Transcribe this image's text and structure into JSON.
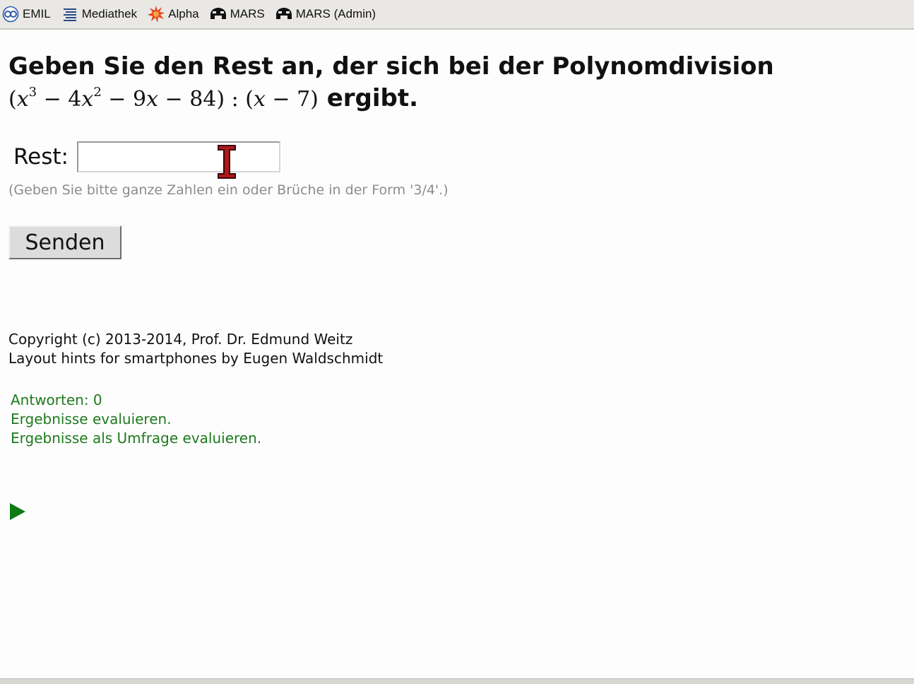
{
  "toolbar": {
    "bookmarks": [
      {
        "label": "EMIL",
        "icon": "emil-logo-icon"
      },
      {
        "label": "Mediathek",
        "icon": "list-icon"
      },
      {
        "label": "Alpha",
        "icon": "starburst-icon"
      },
      {
        "label": "MARS",
        "icon": "mars-logo-icon"
      },
      {
        "label": "MARS (Admin)",
        "icon": "mars-logo-icon"
      }
    ]
  },
  "question": {
    "text_before": "Geben Sie den Rest an, der sich bei der Polynomdivision",
    "formula": "(x³ − 4x² − 9x − 84) : (x − 7)",
    "text_after": "ergibt."
  },
  "answer": {
    "label": "Rest:",
    "value": "",
    "hint": "(Geben Sie bitte ganze Zahlen ein oder Brüche in der Form '3/4'.)",
    "submit_label": "Senden"
  },
  "footer": {
    "copyright": "Copyright (c) 2013-2014, Prof. Dr. Edmund Weitz",
    "layout_hints": "Layout hints for smartphones by Eugen Waldschmidt"
  },
  "stats": {
    "answers": "Antworten: 0",
    "evaluate": "Ergebnisse evaluieren.",
    "evaluate_survey": "Ergebnisse als Umfrage evaluieren."
  },
  "colors": {
    "green_text": "#1f7a1f",
    "hint_gray": "#8c8c8c",
    "alpha_icon": "#e8471c",
    "play_icon": "#0f7a14"
  }
}
